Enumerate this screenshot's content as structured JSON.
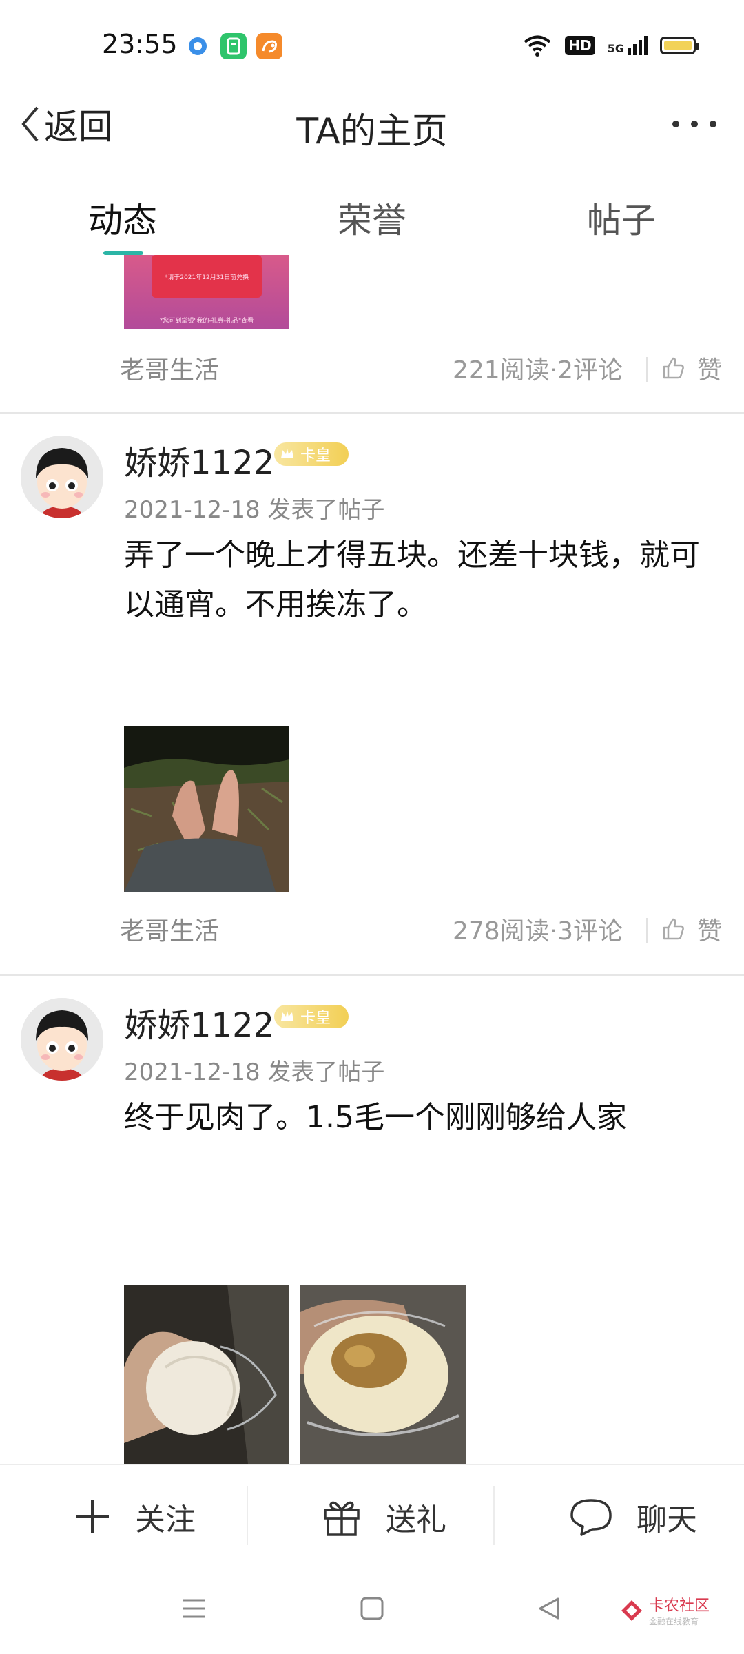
{
  "status_bar": {
    "time": "23:55",
    "network": "5G",
    "hd_label": "HD",
    "app_icons": [
      "browser-app-icon",
      "store-app-icon",
      "uc-browser-app-icon"
    ]
  },
  "nav": {
    "back_label": "返回",
    "title": "TA的主页"
  },
  "tabs": [
    {
      "label": "动态",
      "active": true
    },
    {
      "label": "荣誉",
      "active": false
    },
    {
      "label": "帖子",
      "active": false
    }
  ],
  "posts": [
    {
      "category": "老哥生活",
      "stats": "221阅读·2评论",
      "like_label": "赞",
      "image_text": [
        "*请于2021年12月31日前兑换",
        "*您可到掌银\"我的-礼券-礼品\"查看"
      ]
    },
    {
      "author": "娇娇1122",
      "badge": "卡皇",
      "meta": "2021-12-18  发表了帖子",
      "text": "弄了一个晚上才得五块。还差十块钱，就可以通宵。不用挨冻了。",
      "category": "老哥生活",
      "stats": "278阅读·3评论",
      "like_label": "赞"
    },
    {
      "author": "娇娇1122",
      "badge": "卡皇",
      "meta": "2021-12-18  发表了帖子",
      "text": "终于见肉了。1.5毛一个刚刚够给人家"
    }
  ],
  "bottom_actions": [
    {
      "label": "关注",
      "icon": "plus-icon"
    },
    {
      "label": "送礼",
      "icon": "gift-icon"
    },
    {
      "label": "聊天",
      "icon": "chat-bubble-icon"
    }
  ],
  "watermark": {
    "main": "卡农社区",
    "sub": "金融在线教育"
  },
  "colors": {
    "accent": "#2bb5a6",
    "badge_gold": "#f2cf55",
    "watermark_red": "#d93a4f"
  }
}
